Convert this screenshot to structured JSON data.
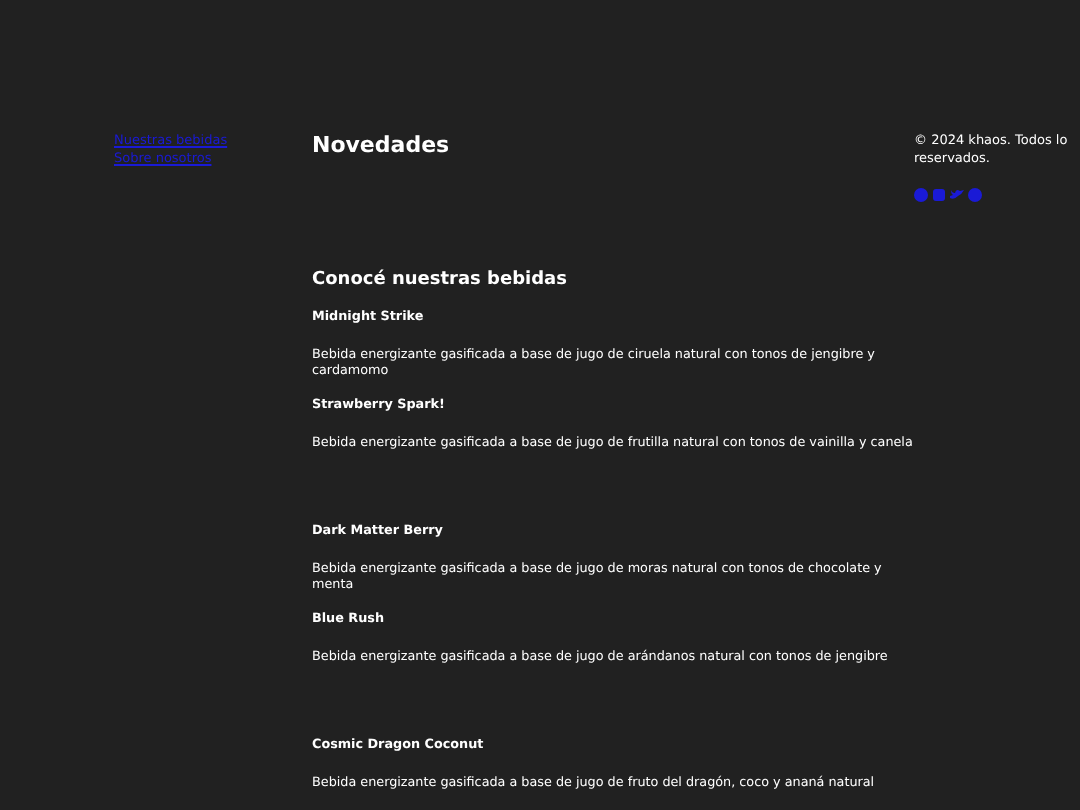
{
  "nav_links": [
    "Nuestras bebidas",
    "Sobre nosotros"
  ],
  "title": "Novedades",
  "section_title": "Conocé nuestras bebidas",
  "drinks": [
    {
      "name": "Midnight Strike",
      "description": "Bebida energizante gasificada a base de jugo de ciruela natural con tonos de jengibre y cardamomo"
    },
    {
      "name": "Strawberry Spark!",
      "description": "Bebida energizante gasificada a base de jugo de frutilla natural con tonos de vainilla y canela"
    },
    {
      "name": "Dark Matter Berry",
      "description": "Bebida energizante gasificada a base de jugo de moras natural con tonos de chocolate y menta"
    },
    {
      "name": "Blue Rush",
      "description": "Bebida energizante gasificada a base de jugo de arándanos natural con tonos de jengibre"
    },
    {
      "name": "Cosmic Dragon Coconut",
      "description": "Bebida energizante gasificada a base de jugo de fruto del dragón, coco y ananá natural"
    }
  ],
  "footer": {
    "copyright_lines": [
      "© 2024 khaos. Todos lo",
      "reservados."
    ]
  }
}
